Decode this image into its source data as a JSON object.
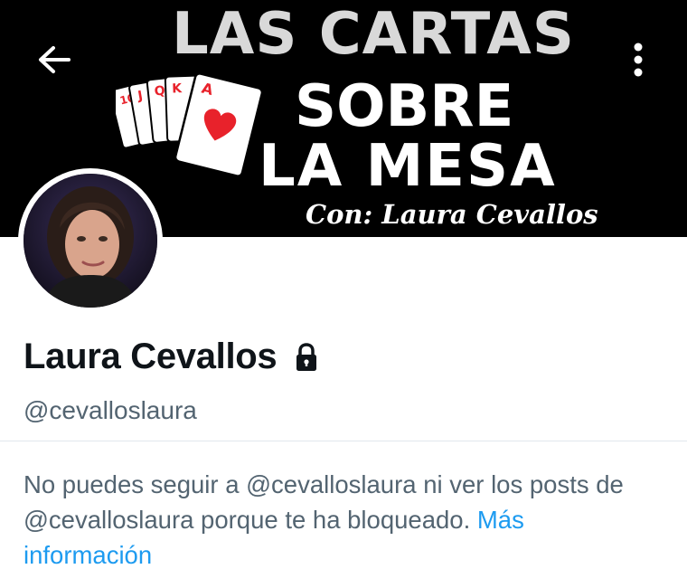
{
  "banner": {
    "title_line1": "LAS CARTAS",
    "title_line2": "SOBRE",
    "title_line3": "LA MESA",
    "subtitle": "Con: Laura Cevallos",
    "card_ranks": [
      "10",
      "J",
      "Q",
      "K",
      "A"
    ],
    "accent_color": "#e8222b"
  },
  "nav": {
    "back_icon": "arrow-left-icon",
    "more_icon": "more-vertical-icon"
  },
  "profile": {
    "name": "Laura Cevallos",
    "handle": "@cevalloslaura",
    "protected_icon": "lock-icon"
  },
  "blocked_notice": {
    "text": "No puedes seguir a @cevalloslaura ni ver los posts de @cevalloslaura porque te ha bloqueado. ",
    "link_label": "Más información",
    "link_color": "#1d9bf0"
  }
}
